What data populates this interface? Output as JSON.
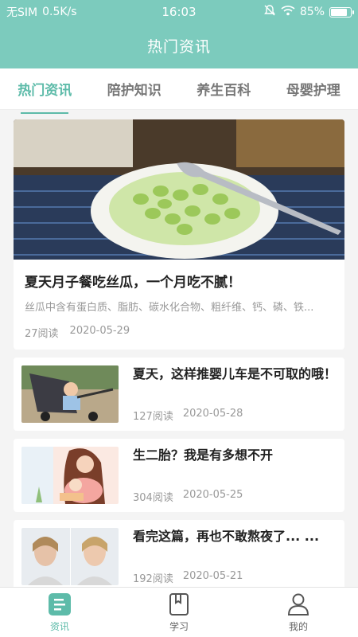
{
  "status": {
    "carrier": "无SIM",
    "speed": "0.5K/s",
    "time": "16:03",
    "battery": "85%",
    "battery_level": 0.85
  },
  "header": {
    "title": "热门资讯"
  },
  "tabs": [
    {
      "label": "热门资讯",
      "active": true
    },
    {
      "label": "陪护知识"
    },
    {
      "label": "养生百科"
    },
    {
      "label": "母婴护理"
    }
  ],
  "featured": {
    "title": "夏天月子餐吃丝瓜，一个月吃不腻！",
    "summary": "丝瓜中含有蛋白质、脂肪、碳水化合物、粗纤维、钙、磷、铁...",
    "reads": "27阅读",
    "date": "2020-05-29"
  },
  "articles": [
    {
      "title": "夏天，这样推婴儿车是不可取的哦！",
      "reads": "127阅读",
      "date": "2020-05-28"
    },
    {
      "title": "生二胎？我是有多想不开",
      "reads": "304阅读",
      "date": "2020-05-25"
    },
    {
      "title": "看完这篇，再也不敢熬夜了... ...",
      "reads": "192阅读",
      "date": "2020-05-21"
    }
  ],
  "nav": [
    {
      "label": "资讯",
      "icon": "news-icon",
      "active": true
    },
    {
      "label": "学习",
      "icon": "book-icon"
    },
    {
      "label": "我的",
      "icon": "user-icon"
    }
  ],
  "colors": {
    "accent": "#5dbba9",
    "header": "#7ccbbd"
  }
}
